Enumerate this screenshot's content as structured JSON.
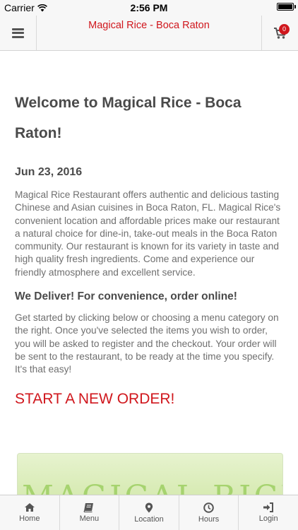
{
  "status_bar": {
    "carrier": "Carrier",
    "time": "2:56 PM"
  },
  "header": {
    "title": "Magical Rice - Boca Raton",
    "cart_count": "0"
  },
  "content": {
    "title": "Welcome to Magical Rice - Boca Raton!",
    "date": "Jun 23, 2016",
    "intro": "Magical Rice Restaurant offers authentic and delicious tasting Chinese and Asian cuisines in Boca Raton, FL. Magical Rice's convenient location and affordable prices make our restaurant a natural choice for dine-in, take-out meals in the Boca Raton community. Our restaurant is known for its variety in taste and high quality fresh ingredients. Come and experience our friendly atmosphere and excellent service.",
    "deliver_heading": "We Deliver! For convenience, order online!",
    "instructions": "Get started by clicking below or choosing a menu category on the right. Once you've selected the items you wish to order, you will be asked to register and the checkout. Your order will be sent to the restaurant, to be ready at the time you specify. It's that easy!",
    "start_order": "START A NEW ORDER!",
    "logo_text": "MAGICAL RICE"
  },
  "tabs": [
    {
      "label": "Home",
      "icon": "home-icon"
    },
    {
      "label": "Menu",
      "icon": "book-icon"
    },
    {
      "label": "Location",
      "icon": "map-marker-icon"
    },
    {
      "label": "Hours",
      "icon": "clock-icon"
    },
    {
      "label": "Login",
      "icon": "sign-in-icon"
    }
  ],
  "colors": {
    "accent": "#d0171d",
    "text": "#555555",
    "bar_background": "#f7f7f7"
  }
}
